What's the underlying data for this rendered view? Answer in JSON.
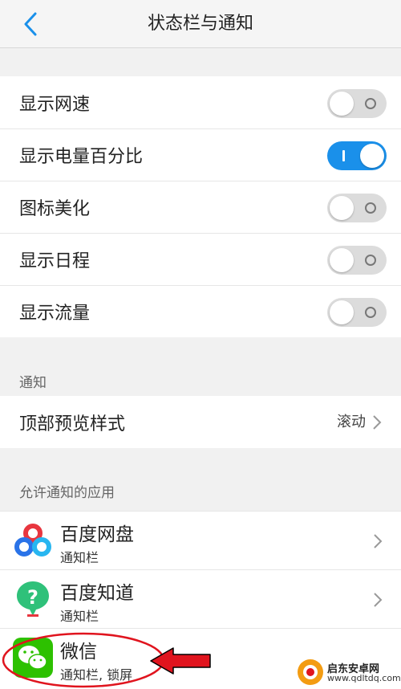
{
  "header": {
    "title": "状态栏与通知"
  },
  "status_bar_settings": [
    {
      "label": "显示网速",
      "enabled": false
    },
    {
      "label": "显示电量百分比",
      "enabled": true
    },
    {
      "label": "图标美化",
      "enabled": false
    },
    {
      "label": "显示日程",
      "enabled": false
    },
    {
      "label": "显示流量",
      "enabled": false
    }
  ],
  "notification": {
    "group_label": "通知",
    "preview_label": "顶部预览样式",
    "preview_value": "滚动"
  },
  "apps": {
    "group_label": "允许通知的应用",
    "items": [
      {
        "name": "百度网盘",
        "sub": "通知栏",
        "icon": "baidu-netdisk-icon"
      },
      {
        "name": "百度知道",
        "sub": "通知栏",
        "icon": "baidu-zhidao-icon"
      },
      {
        "name": "微信",
        "sub": "通知栏, 锁屏",
        "icon": "wechat-icon"
      }
    ]
  },
  "watermark": {
    "name": "启东安卓网",
    "url": "www.qdltdq.com"
  },
  "colors": {
    "accent": "#1a90ea",
    "toggle_off": "#dcdcdc",
    "annotation_red": "#e0141e",
    "wechat_green": "#2dc100"
  }
}
